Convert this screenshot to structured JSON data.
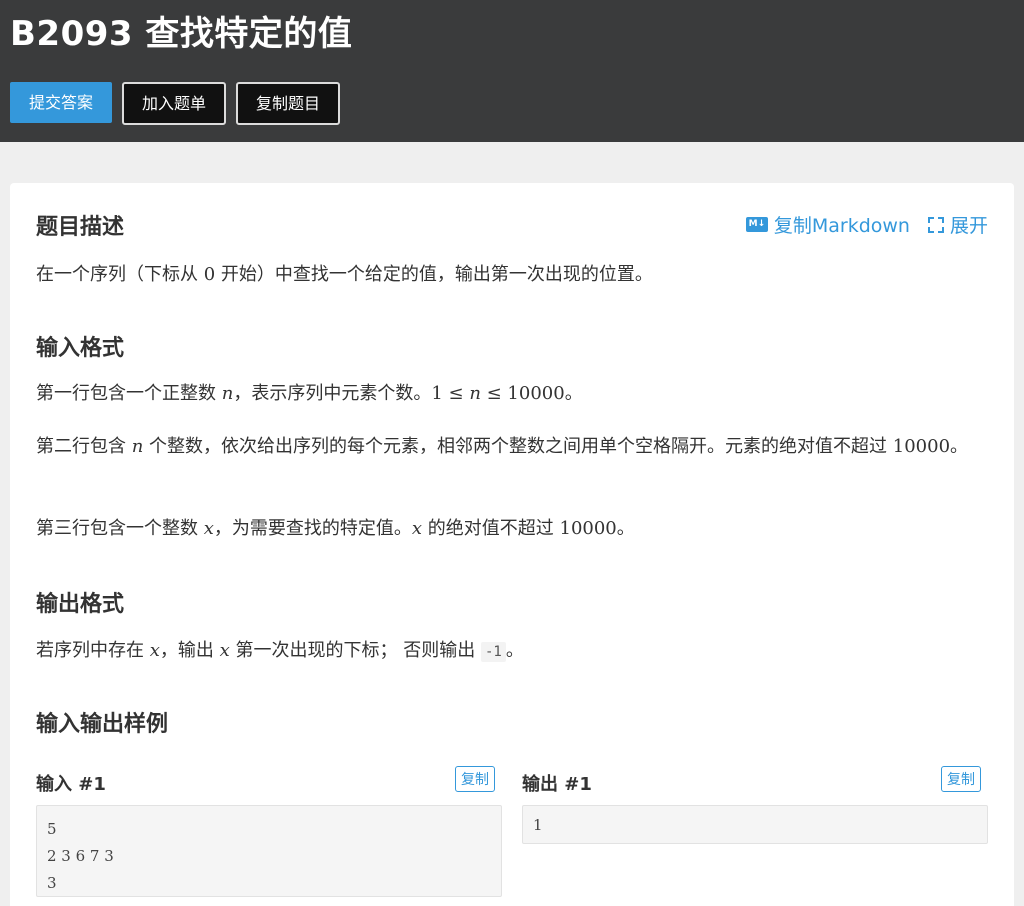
{
  "header": {
    "title": "B2093 查找特定的值",
    "buttons": {
      "submit": "提交答案",
      "add_list": "加入题单",
      "copy_problem": "复制题目"
    }
  },
  "tools": {
    "copy_markdown": "复制Markdown",
    "md_icon": "M↓",
    "expand": "展开"
  },
  "description": {
    "title": "题目描述",
    "t1": "在一个序列（下标从 ",
    "v1": "0",
    "t2": " 开始）中查找一个给定的值，输出第一次出现的位置。"
  },
  "input_format": {
    "title": "输入格式",
    "l1a": "第一行包含一个正整数 ",
    "l1v": "n",
    "l1b": "，表示序列中元素个数。",
    "l1c": "1 ≤ ",
    "l1d": "n",
    "l1e": " ≤ 10000",
    "l1f": "。",
    "l2a": "第二行包含 ",
    "l2v": "n",
    "l2b": " 个整数，依次给出序列的每个元素，相邻两个整数之间用单个空格隔开。元素的绝对值不超过 ",
    "l2c": "10000",
    "l2d": "。",
    "l3a": "第三行包含一个整数 ",
    "l3v": "x",
    "l3b": "，为需要查找的特定值。",
    "l3c": "x",
    "l3d": " 的绝对值不超过 ",
    "l3e": "10000",
    "l3f": "。"
  },
  "output_format": {
    "title": "输出格式",
    "a": "若序列中存在 ",
    "v1": "x",
    "b": "，输出 ",
    "v2": "x",
    "c": " 第一次出现的下标； 否则输出 ",
    "code": "-1",
    "d": "。"
  },
  "samples": {
    "title": "输入输出样例",
    "input_label": "输入 #1",
    "output_label": "输出 #1",
    "copy": "复制",
    "input": "5\n2 3 6 7 3\n3",
    "output": "1"
  },
  "colors": {
    "accent": "#3498db",
    "header_bg": "#3a3b3c"
  }
}
